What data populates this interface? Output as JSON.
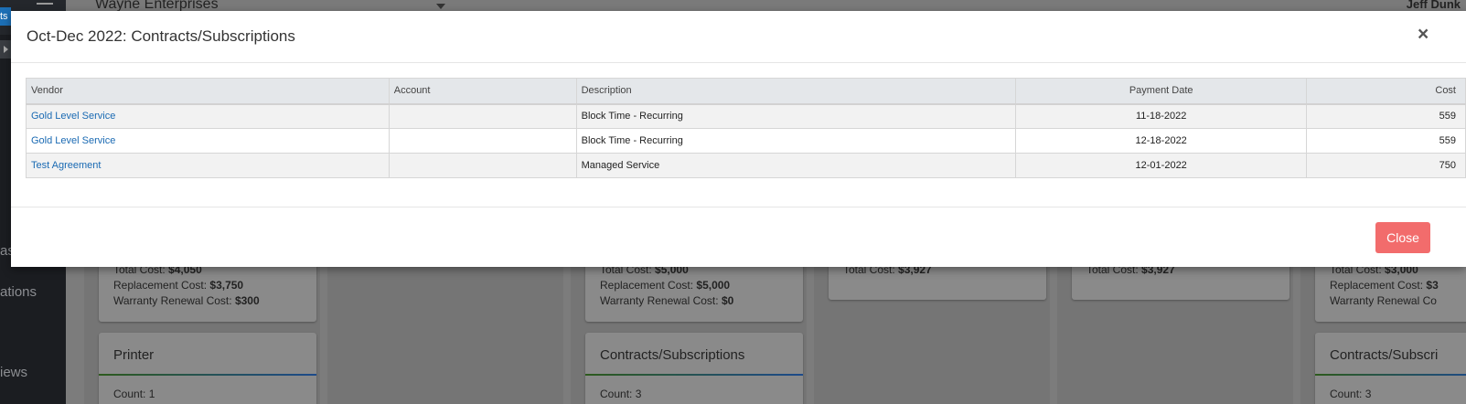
{
  "background": {
    "sidebar": {
      "tab_fragment": "ts",
      "nav_fragments": [
        "as",
        "ations",
        "iews"
      ]
    },
    "header": {
      "company": "Wayne Enterprises",
      "user": "Jeff Dunk"
    },
    "cards_top": [
      {
        "total_label": "Total Cost:",
        "total_value": "$4,050",
        "replacement_label": "Replacement Cost:",
        "replacement_value": "$3,750",
        "warranty_label": "Warranty Renewal Cost:",
        "warranty_value": "$300"
      },
      {
        "total_label": "Total Cost:",
        "total_value": "$5,000",
        "replacement_label": "Replacement Cost:",
        "replacement_value": "$5,000",
        "warranty_label": "Warranty Renewal Cost:",
        "warranty_value": "$0"
      },
      {
        "total_label": "Total Cost:",
        "total_value": "$3,927"
      },
      {
        "total_label": "Total Cost:",
        "total_value": "$3,927"
      },
      {
        "total_label": "Total Cost:",
        "total_value": "$3,000",
        "replacement_label": "Replacement Cost:",
        "replacement_value": "$3",
        "warranty_label": "Warranty Renewal Co"
      }
    ],
    "cards_bottom": [
      {
        "title": "Printer",
        "count": "Count: 1"
      },
      {
        "title": "Contracts/Subscriptions",
        "count": "Count: 3"
      },
      {
        "title": "Contracts/Subscri",
        "count": "Count: 3"
      }
    ]
  },
  "modal": {
    "title": "Oct-Dec 2022: Contracts/Subscriptions",
    "close_x": "×",
    "table": {
      "headers": {
        "vendor": "Vendor",
        "account": "Account",
        "description": "Description",
        "payment_date": "Payment Date",
        "cost": "Cost"
      },
      "rows": [
        {
          "vendor": "Gold Level Service",
          "account": "",
          "description": "Block Time - Recurring",
          "payment_date": "11-18-2022",
          "cost": "559"
        },
        {
          "vendor": "Gold Level Service",
          "account": "",
          "description": "Block Time - Recurring",
          "payment_date": "12-18-2022",
          "cost": "559"
        },
        {
          "vendor": "Test Agreement",
          "account": "",
          "description": "Managed Service",
          "payment_date": "12-01-2022",
          "cost": "750"
        }
      ]
    },
    "close_button": "Close",
    "colors": {
      "link": "#1a6ab3",
      "close_button": "#f26c6c",
      "header_bg": "#e4e7ea"
    }
  }
}
